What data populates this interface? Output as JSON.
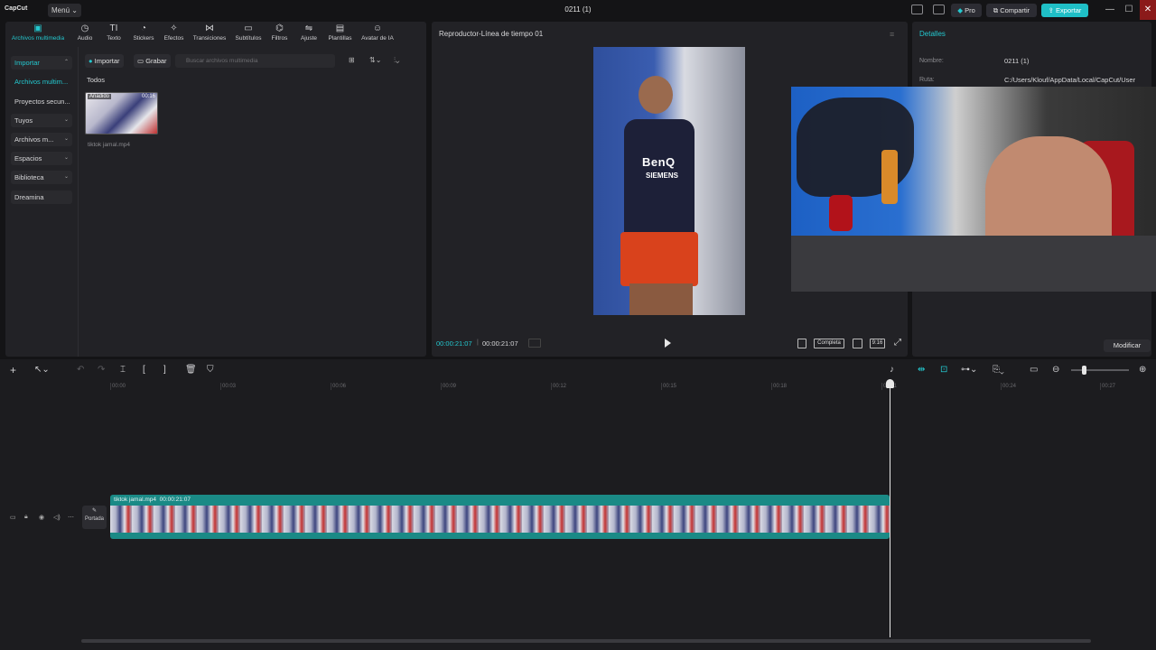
{
  "titlebar": {
    "logo": "CapCut",
    "menu_label": "Menú ⌄",
    "project_title": "0211 (1)",
    "pro_label": "Pro",
    "share_label": "Compartir",
    "export_label": "Exportar",
    "minimize": "—",
    "maximize": "☐",
    "close": "✕"
  },
  "media_tabs": [
    {
      "label": "Archivos multimedia",
      "icon": "media-icon",
      "glyph": "▣"
    },
    {
      "label": "Audio",
      "icon": "audio-icon",
      "glyph": "◷"
    },
    {
      "label": "Texto",
      "icon": "text-icon",
      "glyph": "TI"
    },
    {
      "label": "Stickers",
      "icon": "sticker-icon",
      "glyph": "◔"
    },
    {
      "label": "Efectos",
      "icon": "effects-icon",
      "glyph": "✧"
    },
    {
      "label": "Transiciones",
      "icon": "transition-icon",
      "glyph": "⋈"
    },
    {
      "label": "Subtítulos",
      "icon": "subtitle-icon",
      "glyph": "▭"
    },
    {
      "label": "Filtros",
      "icon": "filter-icon",
      "glyph": "⌬"
    },
    {
      "label": "Ajuste",
      "icon": "adjust-icon",
      "glyph": "⇋"
    },
    {
      "label": "Plantillas",
      "icon": "template-icon",
      "glyph": "▤"
    },
    {
      "label": "Avatar de IA",
      "icon": "ai-avatar-icon",
      "glyph": "☺"
    }
  ],
  "left_nav": [
    {
      "label": "Importar"
    },
    {
      "label": "Archivos multim..."
    },
    {
      "label": "Proyectos secun..."
    },
    {
      "label": "Tuyos"
    },
    {
      "label": "Archivos m..."
    },
    {
      "label": "Espacios"
    },
    {
      "label": "Biblioteca"
    },
    {
      "label": "Dreamina"
    }
  ],
  "media": {
    "import_label": "Importar",
    "record_label": "Grabar",
    "search_placeholder": "Buscar archivos multimedia",
    "section_label": "Todos",
    "item_badge": "Añadido",
    "item_duration": "00:16",
    "item_name": "tiktok jamal.mp4"
  },
  "player": {
    "title": "Reproductor-Línea de tiempo 01",
    "video_text": "BenQ",
    "video_text2": "SIEMENS",
    "current_time": "00:00:21:07",
    "total_time": "00:00:21:07",
    "ratio_label": "Completa",
    "aspect_label": "9:16"
  },
  "details": {
    "title": "Detalles",
    "name_label": "Nombre:",
    "name_value": "0211 (1)",
    "path_label": "Ruta:",
    "path_value": "C:/Users/Klouf/AppData/Local/CapCut/User",
    "modify_label": "Modificar"
  },
  "timeline": {
    "ruler_ticks": [
      "00:00",
      "00:03",
      "00:06",
      "00:09",
      "00:12",
      "00:15",
      "00:18",
      "00:21",
      "00:24",
      "00:27"
    ],
    "clip_name": "tiktok jamal.mp4",
    "clip_duration": "00:00:21:07",
    "cover_label": "Portada"
  },
  "colors": {
    "accent": "#24c8cf",
    "export": "#1fbfc6",
    "clip": "#1a8a86",
    "close": "#8b1a1a"
  }
}
